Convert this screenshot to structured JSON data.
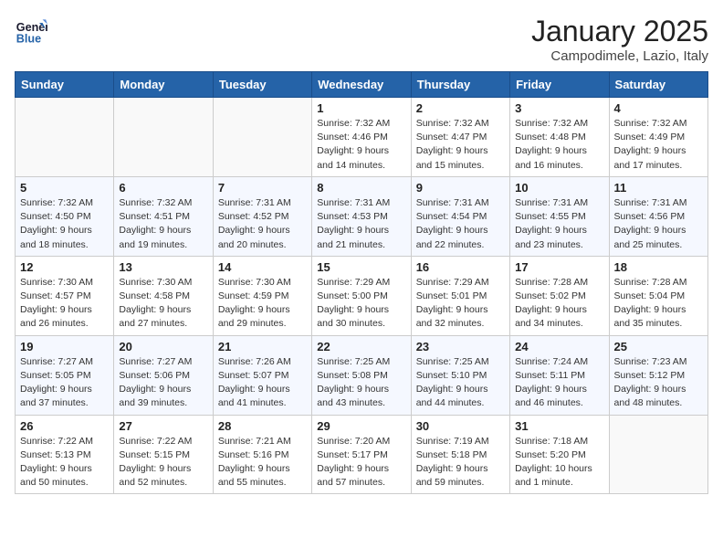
{
  "header": {
    "logo_line1": "General",
    "logo_line2": "Blue",
    "month": "January 2025",
    "location": "Campodimele, Lazio, Italy"
  },
  "weekdays": [
    "Sunday",
    "Monday",
    "Tuesday",
    "Wednesday",
    "Thursday",
    "Friday",
    "Saturday"
  ],
  "weeks": [
    [
      {
        "day": "",
        "detail": ""
      },
      {
        "day": "",
        "detail": ""
      },
      {
        "day": "",
        "detail": ""
      },
      {
        "day": "1",
        "detail": "Sunrise: 7:32 AM\nSunset: 4:46 PM\nDaylight: 9 hours\nand 14 minutes."
      },
      {
        "day": "2",
        "detail": "Sunrise: 7:32 AM\nSunset: 4:47 PM\nDaylight: 9 hours\nand 15 minutes."
      },
      {
        "day": "3",
        "detail": "Sunrise: 7:32 AM\nSunset: 4:48 PM\nDaylight: 9 hours\nand 16 minutes."
      },
      {
        "day": "4",
        "detail": "Sunrise: 7:32 AM\nSunset: 4:49 PM\nDaylight: 9 hours\nand 17 minutes."
      }
    ],
    [
      {
        "day": "5",
        "detail": "Sunrise: 7:32 AM\nSunset: 4:50 PM\nDaylight: 9 hours\nand 18 minutes."
      },
      {
        "day": "6",
        "detail": "Sunrise: 7:32 AM\nSunset: 4:51 PM\nDaylight: 9 hours\nand 19 minutes."
      },
      {
        "day": "7",
        "detail": "Sunrise: 7:31 AM\nSunset: 4:52 PM\nDaylight: 9 hours\nand 20 minutes."
      },
      {
        "day": "8",
        "detail": "Sunrise: 7:31 AM\nSunset: 4:53 PM\nDaylight: 9 hours\nand 21 minutes."
      },
      {
        "day": "9",
        "detail": "Sunrise: 7:31 AM\nSunset: 4:54 PM\nDaylight: 9 hours\nand 22 minutes."
      },
      {
        "day": "10",
        "detail": "Sunrise: 7:31 AM\nSunset: 4:55 PM\nDaylight: 9 hours\nand 23 minutes."
      },
      {
        "day": "11",
        "detail": "Sunrise: 7:31 AM\nSunset: 4:56 PM\nDaylight: 9 hours\nand 25 minutes."
      }
    ],
    [
      {
        "day": "12",
        "detail": "Sunrise: 7:30 AM\nSunset: 4:57 PM\nDaylight: 9 hours\nand 26 minutes."
      },
      {
        "day": "13",
        "detail": "Sunrise: 7:30 AM\nSunset: 4:58 PM\nDaylight: 9 hours\nand 27 minutes."
      },
      {
        "day": "14",
        "detail": "Sunrise: 7:30 AM\nSunset: 4:59 PM\nDaylight: 9 hours\nand 29 minutes."
      },
      {
        "day": "15",
        "detail": "Sunrise: 7:29 AM\nSunset: 5:00 PM\nDaylight: 9 hours\nand 30 minutes."
      },
      {
        "day": "16",
        "detail": "Sunrise: 7:29 AM\nSunset: 5:01 PM\nDaylight: 9 hours\nand 32 minutes."
      },
      {
        "day": "17",
        "detail": "Sunrise: 7:28 AM\nSunset: 5:02 PM\nDaylight: 9 hours\nand 34 minutes."
      },
      {
        "day": "18",
        "detail": "Sunrise: 7:28 AM\nSunset: 5:04 PM\nDaylight: 9 hours\nand 35 minutes."
      }
    ],
    [
      {
        "day": "19",
        "detail": "Sunrise: 7:27 AM\nSunset: 5:05 PM\nDaylight: 9 hours\nand 37 minutes."
      },
      {
        "day": "20",
        "detail": "Sunrise: 7:27 AM\nSunset: 5:06 PM\nDaylight: 9 hours\nand 39 minutes."
      },
      {
        "day": "21",
        "detail": "Sunrise: 7:26 AM\nSunset: 5:07 PM\nDaylight: 9 hours\nand 41 minutes."
      },
      {
        "day": "22",
        "detail": "Sunrise: 7:25 AM\nSunset: 5:08 PM\nDaylight: 9 hours\nand 43 minutes."
      },
      {
        "day": "23",
        "detail": "Sunrise: 7:25 AM\nSunset: 5:10 PM\nDaylight: 9 hours\nand 44 minutes."
      },
      {
        "day": "24",
        "detail": "Sunrise: 7:24 AM\nSunset: 5:11 PM\nDaylight: 9 hours\nand 46 minutes."
      },
      {
        "day": "25",
        "detail": "Sunrise: 7:23 AM\nSunset: 5:12 PM\nDaylight: 9 hours\nand 48 minutes."
      }
    ],
    [
      {
        "day": "26",
        "detail": "Sunrise: 7:22 AM\nSunset: 5:13 PM\nDaylight: 9 hours\nand 50 minutes."
      },
      {
        "day": "27",
        "detail": "Sunrise: 7:22 AM\nSunset: 5:15 PM\nDaylight: 9 hours\nand 52 minutes."
      },
      {
        "day": "28",
        "detail": "Sunrise: 7:21 AM\nSunset: 5:16 PM\nDaylight: 9 hours\nand 55 minutes."
      },
      {
        "day": "29",
        "detail": "Sunrise: 7:20 AM\nSunset: 5:17 PM\nDaylight: 9 hours\nand 57 minutes."
      },
      {
        "day": "30",
        "detail": "Sunrise: 7:19 AM\nSunset: 5:18 PM\nDaylight: 9 hours\nand 59 minutes."
      },
      {
        "day": "31",
        "detail": "Sunrise: 7:18 AM\nSunset: 5:20 PM\nDaylight: 10 hours\nand 1 minute."
      },
      {
        "day": "",
        "detail": ""
      }
    ]
  ]
}
